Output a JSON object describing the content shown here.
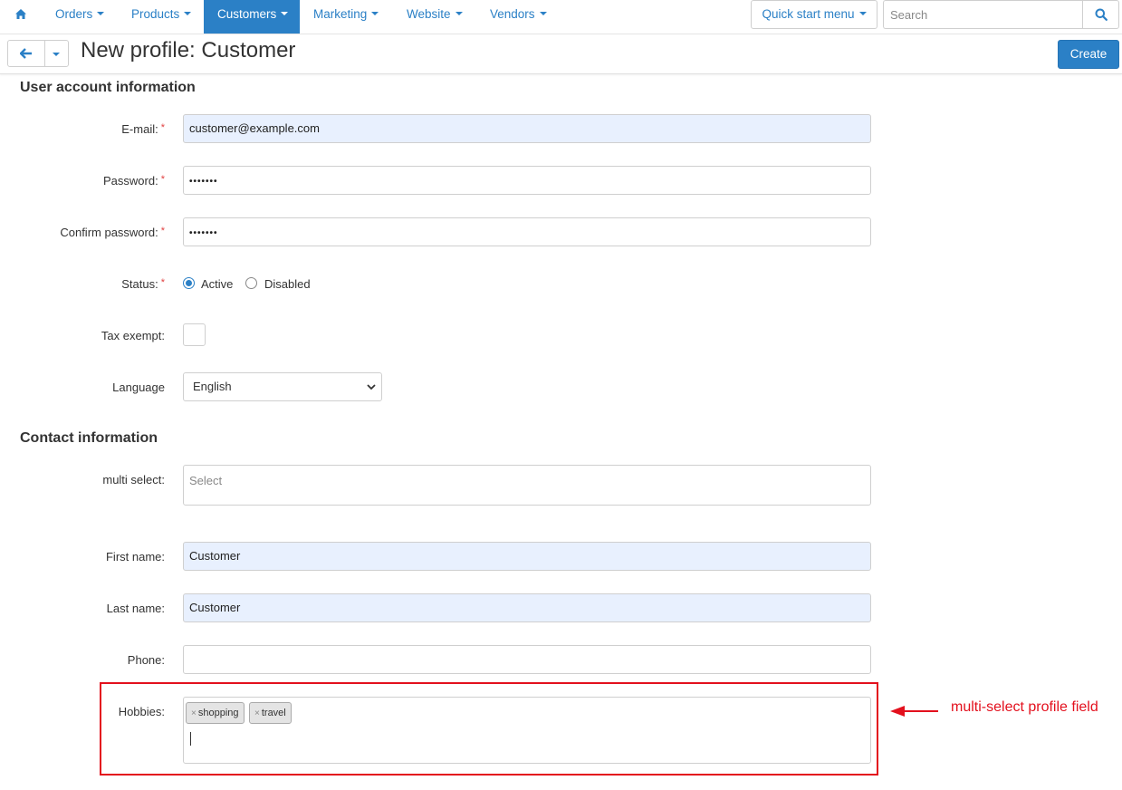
{
  "nav": {
    "items": [
      {
        "label": "Orders",
        "active": false
      },
      {
        "label": "Products",
        "active": false
      },
      {
        "label": "Customers",
        "active": true
      },
      {
        "label": "Marketing",
        "active": false
      },
      {
        "label": "Website",
        "active": false
      },
      {
        "label": "Vendors",
        "active": false
      }
    ],
    "quick_start": "Quick start menu",
    "search_placeholder": "Search"
  },
  "header": {
    "title": "New profile: Customer",
    "create_label": "Create"
  },
  "sections": {
    "user_account": "User account information",
    "contact": "Contact information"
  },
  "form": {
    "email": {
      "label": "E-mail:",
      "value": "customer@example.com"
    },
    "password": {
      "label": "Password:",
      "value": "•••••••"
    },
    "confirm_password": {
      "label": "Confirm password:",
      "value": "•••••••"
    },
    "status": {
      "label": "Status:",
      "options": [
        "Active",
        "Disabled"
      ],
      "selected": "Active"
    },
    "tax_exempt": {
      "label": "Tax exempt:",
      "checked": false
    },
    "language": {
      "label": "Language",
      "value": "English"
    },
    "multi_select": {
      "label": "multi select:",
      "placeholder": "Select"
    },
    "first_name": {
      "label": "First name:",
      "value": "Customer"
    },
    "last_name": {
      "label": "Last name:",
      "value": "Customer"
    },
    "phone": {
      "label": "Phone:",
      "value": ""
    },
    "hobbies": {
      "label": "Hobbies:",
      "tags": [
        "shopping",
        "travel"
      ]
    }
  },
  "annotation": {
    "text": "multi-select profile field",
    "color": "#e3101d"
  },
  "colors": {
    "accent": "#2b80c6",
    "autofill_bg": "#e8f0fe",
    "required": "#e14040"
  }
}
